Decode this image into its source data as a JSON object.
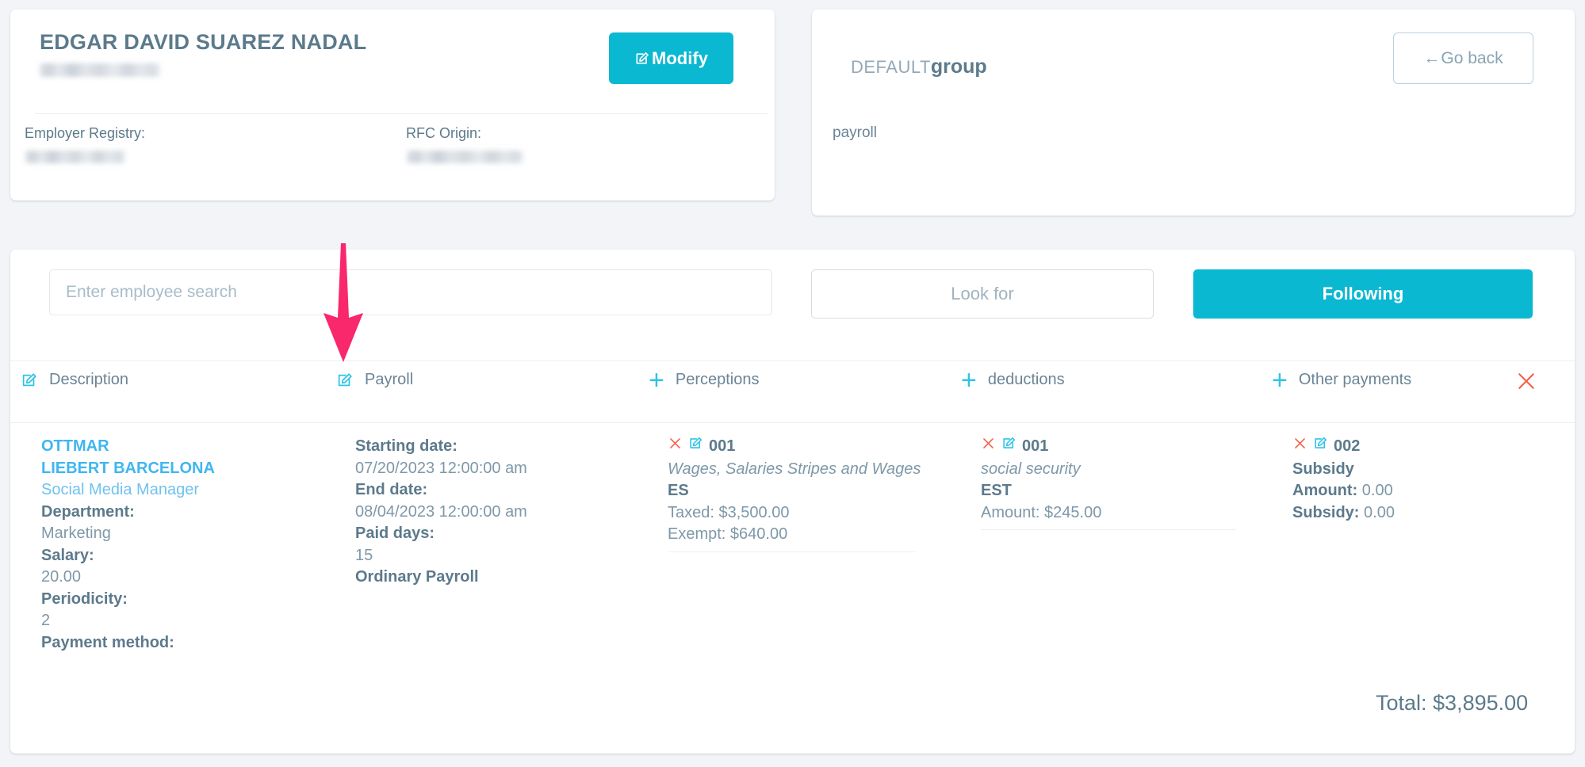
{
  "employee_card": {
    "name": "EDGAR DAVID SUAREZ NADAL",
    "employer_registry_label": "Employer Registry:",
    "rfc_origin_label": "RFC Origin:",
    "modify_button": "Modify",
    "modify_icon": "edit-square-pencil-icon"
  },
  "group_card": {
    "title_prefix": "DEFAULT",
    "title_main": "group",
    "subtitle": "payroll",
    "go_back_button": "Go back",
    "go_back_icon": "arrow-left-icon"
  },
  "search_row": {
    "search_placeholder": "Enter employee search",
    "search_value": "",
    "look_for_button": "Look for",
    "following_button": "Following"
  },
  "table": {
    "columns": [
      {
        "label": "Description",
        "icon": "edit-square-pencil-icon"
      },
      {
        "label": "Payroll",
        "icon": "edit-square-pencil-icon"
      },
      {
        "label": "Perceptions",
        "icon": "plus-icon"
      },
      {
        "label": "deductions",
        "icon": "plus-icon"
      },
      {
        "label": "Other payments",
        "icon": "plus-icon"
      }
    ],
    "close_icon": "close-x-icon",
    "description_cell": {
      "employee_first_line": "OTTMAR",
      "employee_second_line": "LIEBERT BARCELONA",
      "role": "Social Media Manager",
      "department_label": "Department:",
      "department_value": "Marketing",
      "salary_label": "Salary:",
      "salary_value": "20.00",
      "periodicity_label": "Periodicity:",
      "periodicity_value": "2",
      "payment_method_label": "Payment method:"
    },
    "payroll_cell": {
      "starting_date_label": "Starting date:",
      "starting_date_value": "07/20/2023 12:00:00 am",
      "end_date_label": "End date:",
      "end_date_value": "08/04/2023 12:00:00 am",
      "paid_days_label": "Paid days:",
      "paid_days_value": "15",
      "payroll_type": "Ordinary Payroll"
    },
    "perceptions_cell": {
      "code": "001",
      "description": "Wages, Salaries Stripes and Wages",
      "type": "ES",
      "taxed": "Taxed: $3,500.00",
      "exempt": "Exempt: $640.00",
      "delete_icon": "close-x-icon",
      "edit_icon": "edit-square-pencil-icon"
    },
    "deductions_cell": {
      "code": "001",
      "description": "social security",
      "type": "EST",
      "amount": "Amount: $245.00",
      "delete_icon": "close-x-icon",
      "edit_icon": "edit-square-pencil-icon"
    },
    "other_payments_cell": {
      "code": "002",
      "description": "Subsidy",
      "amount_label": "Amount:",
      "amount_value": "0.00",
      "subsidy_label": "Subsidy:",
      "subsidy_value": "0.00",
      "delete_icon": "close-x-icon",
      "edit_icon": "edit-square-pencil-icon"
    },
    "total": "Total: $3,895.00"
  },
  "annotation": {
    "arrow": "down-arrow-annotation",
    "color": "#f9276b"
  },
  "colors": {
    "accent": "#0ab8d2",
    "icon_blue": "#2ec4e6",
    "link_blue": "#3fb6f0",
    "text": "#5c7a8c",
    "muted": "#7e98a8",
    "danger": "#f4614a",
    "background": "#f2f4f7"
  }
}
